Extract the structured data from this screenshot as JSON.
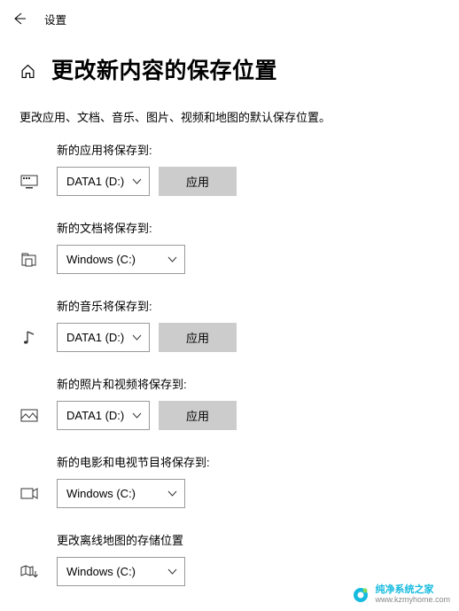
{
  "header": {
    "title": "设置"
  },
  "page": {
    "title": "更改新内容的保存位置",
    "description": "更改应用、文档、音乐、图片、视频和地图的默认保存位置。"
  },
  "settings": {
    "apps": {
      "label": "新的应用将保存到:",
      "value": "DATA1 (D:)",
      "applyLabel": "应用",
      "showApply": true
    },
    "documents": {
      "label": "新的文档将保存到:",
      "value": "Windows (C:)",
      "showApply": false
    },
    "music": {
      "label": "新的音乐将保存到:",
      "value": "DATA1 (D:)",
      "applyLabel": "应用",
      "showApply": true
    },
    "photos": {
      "label": "新的照片和视频将保存到:",
      "value": "DATA1 (D:)",
      "applyLabel": "应用",
      "showApply": true
    },
    "movies": {
      "label": "新的电影和电视节目将保存到:",
      "value": "Windows (C:)",
      "showApply": false
    },
    "maps": {
      "label": "更改离线地图的存储位置",
      "value": "Windows (C:)",
      "showApply": false
    }
  },
  "watermark": {
    "title": "纯净系统之家",
    "url": "www.kzmyhome.com"
  }
}
